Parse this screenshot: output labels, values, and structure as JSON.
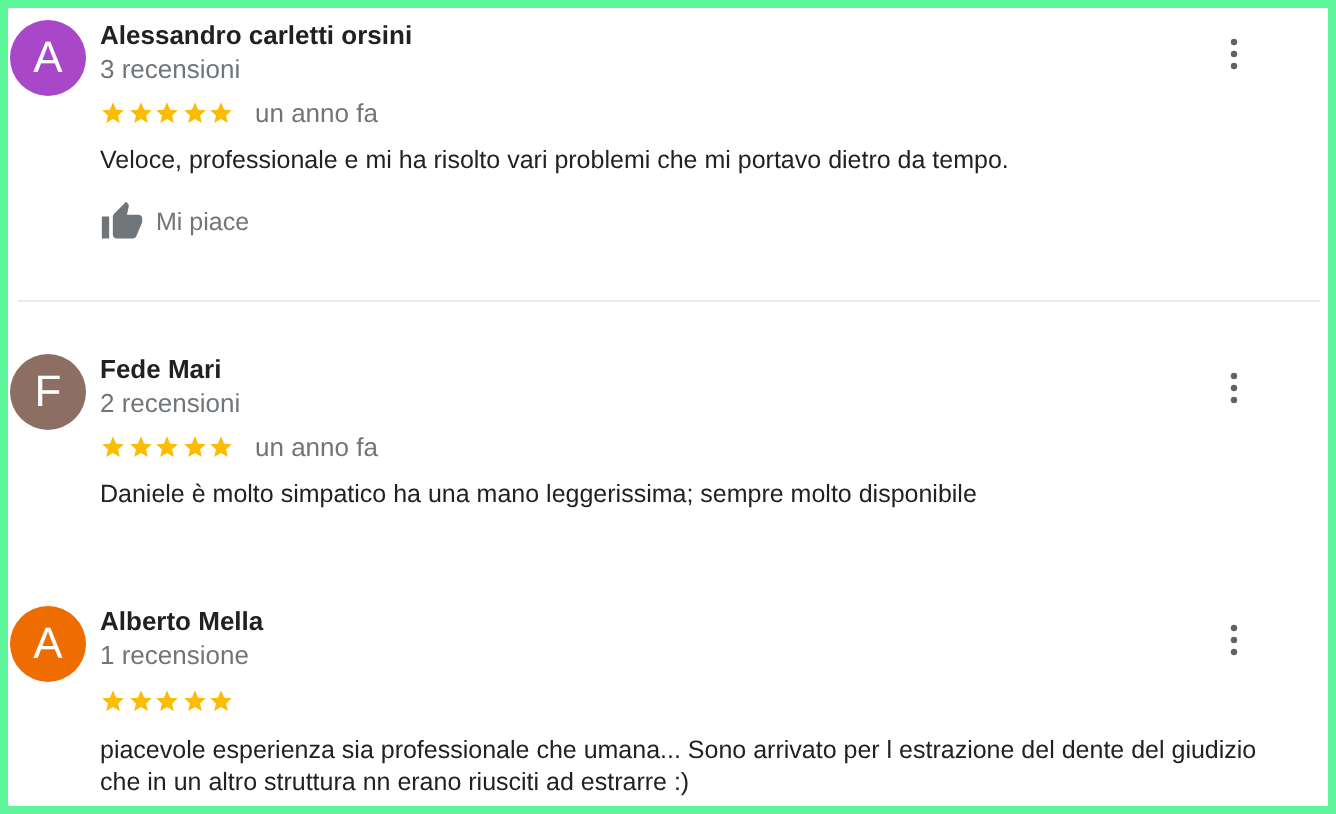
{
  "reviews": [
    {
      "avatar_letter": "A",
      "color": "#a848c8",
      "name": "Alessandro carletti orsini",
      "review_count": "3 recensioni",
      "stars": 5,
      "time": "un anno fa",
      "text": "Veloce, professionale e mi ha risolto vari problemi che mi portavo dietro da tempo.",
      "like": "Mi piace",
      "divider_after": true
    },
    {
      "avatar_letter": "F",
      "color": "#8d6e63",
      "name": "Fede Mari",
      "review_count": "2 recensioni",
      "stars": 5,
      "time": "un anno fa",
      "text": "Daniele è molto simpatico ha una mano leggerissima; sempre molto disponibile",
      "divider_after": false
    },
    {
      "avatar_letter": "A",
      "color": "#ef6c00",
      "name": "Alberto Mella",
      "review_count": "1 recensione",
      "stars": 5,
      "text": "piacevole esperienza sia professionale che umana... Sono arrivato per l estrazione del dente del giudizio che in un altro struttura nn erano riusciti ad estrarre :)",
      "divider_after": false
    }
  ]
}
